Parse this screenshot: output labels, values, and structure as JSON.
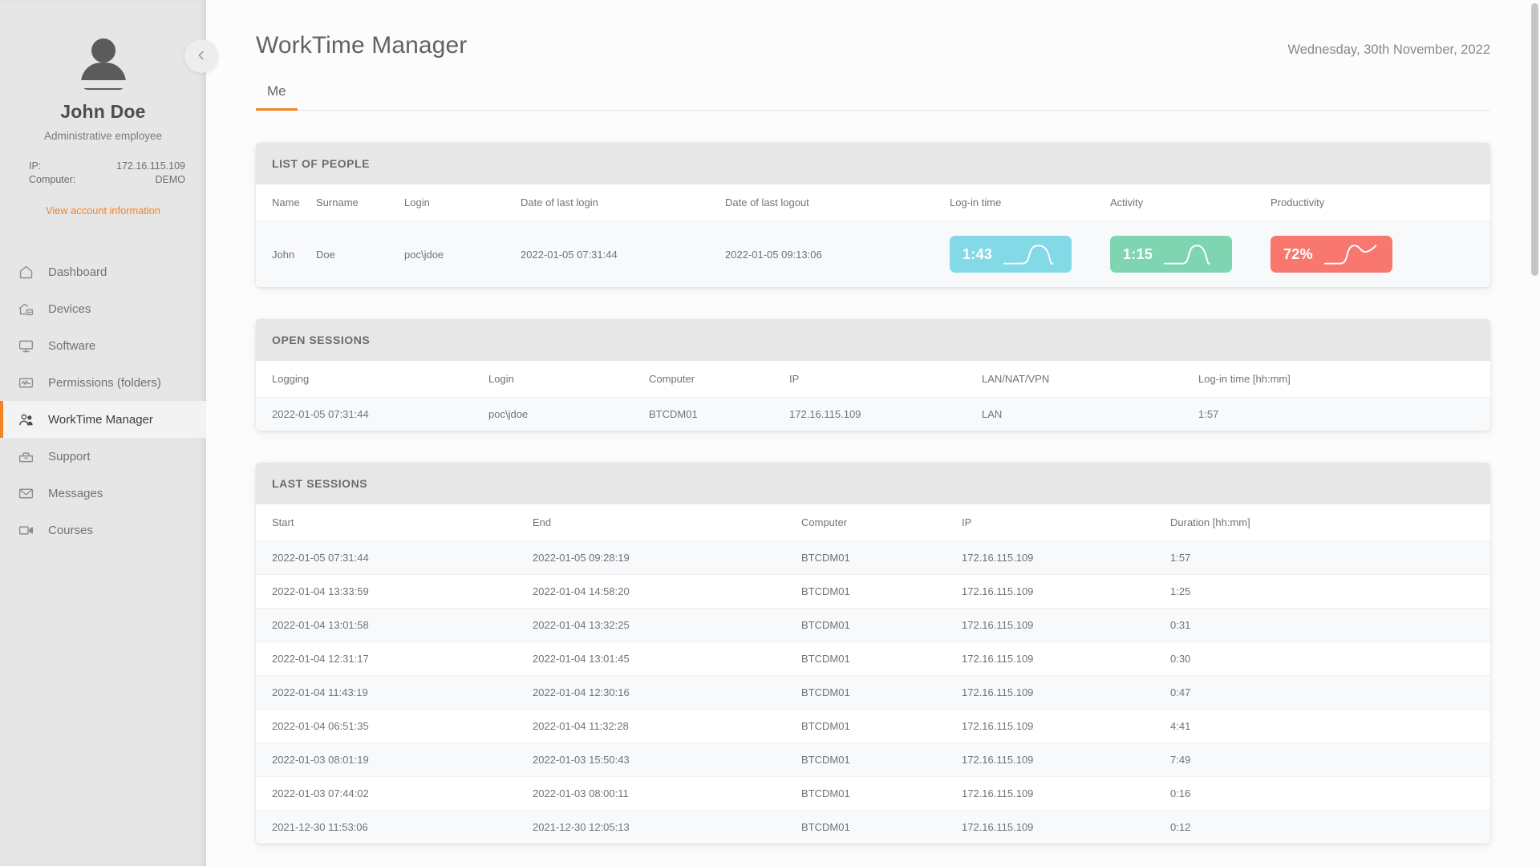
{
  "sidebar": {
    "user": {
      "name": "John Doe",
      "role": "Administrative employee",
      "ip_label": "IP:",
      "ip_value": "172.16.115.109",
      "computer_label": "Computer:",
      "computer_value": "DEMO",
      "account_link": "View account information"
    },
    "items": [
      {
        "label": "Dashboard",
        "icon": "home-icon",
        "active": false
      },
      {
        "label": "Devices",
        "icon": "devices-icon",
        "active": false
      },
      {
        "label": "Software",
        "icon": "monitor-icon",
        "active": false
      },
      {
        "label": "Permissions (folders)",
        "icon": "permissions-icon",
        "active": false
      },
      {
        "label": "WorkTime Manager",
        "icon": "people-icon",
        "active": true
      },
      {
        "label": "Support",
        "icon": "toolbox-icon",
        "active": false
      },
      {
        "label": "Messages",
        "icon": "envelope-icon",
        "active": false
      },
      {
        "label": "Courses",
        "icon": "video-icon",
        "active": false
      }
    ],
    "collapse_icon": "chevron-left-icon",
    "accent_color": "#f58220"
  },
  "header": {
    "title": "WorkTime Manager",
    "date": "Wednesday, 30th November, 2022"
  },
  "tabs": [
    {
      "label": "Me",
      "active": true
    }
  ],
  "list_of_people": {
    "title": "LIST OF PEOPLE",
    "columns": [
      "Name",
      "Surname",
      "Login",
      "Date of last login",
      "Date of last logout",
      "Log-in time",
      "Activity",
      "Productivity"
    ],
    "rows": [
      {
        "name": "John",
        "surname": "Doe",
        "login": "poc\\jdoe",
        "date_last_login": "2022-01-05 07:31:44",
        "date_last_logout": "2022-01-05 09:13:06",
        "login_time": "1:43",
        "activity": "1:15",
        "productivity": "72%"
      }
    ],
    "badge_colors": {
      "login_time": "#83d9e6",
      "activity": "#7fd5b1",
      "productivity": "#f8786f"
    }
  },
  "open_sessions": {
    "title": "OPEN SESSIONS",
    "columns": [
      "Logging",
      "Login",
      "Computer",
      "IP",
      "LAN/NAT/VPN",
      "Log-in time [hh:mm]"
    ],
    "rows": [
      [
        "2022-01-05 07:31:44",
        "poc\\jdoe",
        "BTCDM01",
        "172.16.115.109",
        "LAN",
        "1:57"
      ]
    ]
  },
  "last_sessions": {
    "title": "LAST SESSIONS",
    "columns": [
      "Start",
      "End",
      "Computer",
      "IP",
      "Duration [hh:mm]"
    ],
    "rows": [
      [
        "2022-01-05 07:31:44",
        "2022-01-05 09:28:19",
        "BTCDM01",
        "172.16.115.109",
        "1:57"
      ],
      [
        "2022-01-04 13:33:59",
        "2022-01-04 14:58:20",
        "BTCDM01",
        "172.16.115.109",
        "1:25"
      ],
      [
        "2022-01-04 13:01:58",
        "2022-01-04 13:32:25",
        "BTCDM01",
        "172.16.115.109",
        "0:31"
      ],
      [
        "2022-01-04 12:31:17",
        "2022-01-04 13:01:45",
        "BTCDM01",
        "172.16.115.109",
        "0:30"
      ],
      [
        "2022-01-04 11:43:19",
        "2022-01-04 12:30:16",
        "BTCDM01",
        "172.16.115.109",
        "0:47"
      ],
      [
        "2022-01-04 06:51:35",
        "2022-01-04 11:32:28",
        "BTCDM01",
        "172.16.115.109",
        "4:41"
      ],
      [
        "2022-01-03 08:01:19",
        "2022-01-03 15:50:43",
        "BTCDM01",
        "172.16.115.109",
        "7:49"
      ],
      [
        "2022-01-03 07:44:02",
        "2022-01-03 08:00:11",
        "BTCDM01",
        "172.16.115.109",
        "0:16"
      ],
      [
        "2021-12-30 11:53:06",
        "2021-12-30 12:05:13",
        "BTCDM01",
        "172.16.115.109",
        "0:12"
      ]
    ]
  }
}
